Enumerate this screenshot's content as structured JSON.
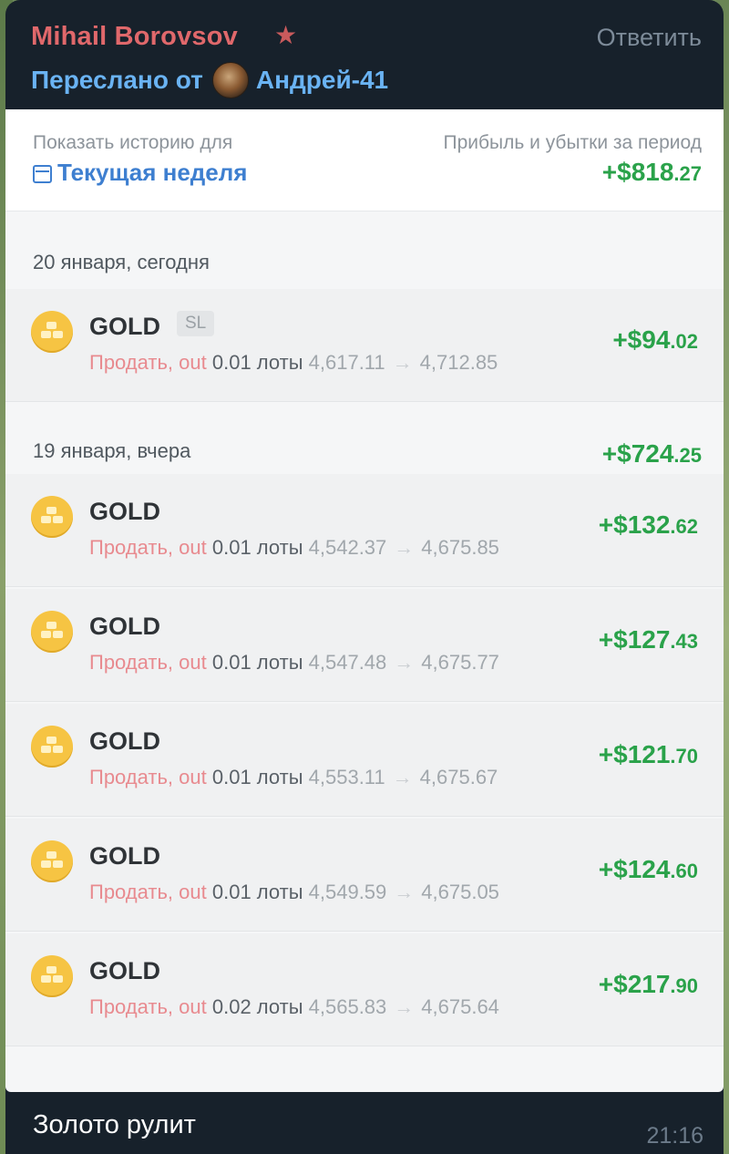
{
  "message": {
    "sender": "Mihail Borovsov",
    "reply_label": "Ответить",
    "forwarded_label": "Переслано от",
    "forwarded_from": "Андрей-41",
    "caption": "Золото рулит",
    "time": "21:16"
  },
  "summary": {
    "history_label": "Показать историю для",
    "period": "Текущая неделя",
    "pnl_label": "Прибыль и убытки за период",
    "pnl_main": "+$818",
    "pnl_cents": ".27"
  },
  "days": [
    {
      "label": "20 января, сегодня",
      "total_main": "",
      "total_cents": "",
      "trades": [
        {
          "symbol": "GOLD",
          "tag": "SL",
          "side": "Продать, out",
          "lots": "0.01 лоты",
          "open": "4,617.11",
          "close": "4,712.85",
          "profit_main": "+$94",
          "profit_cents": ".02"
        }
      ]
    },
    {
      "label": "19 января, вчера",
      "total_main": "+$724",
      "total_cents": ".25",
      "trades": [
        {
          "symbol": "GOLD",
          "tag": "",
          "side": "Продать, out",
          "lots": "0.01 лоты",
          "open": "4,542.37",
          "close": "4,675.85",
          "profit_main": "+$132",
          "profit_cents": ".62"
        },
        {
          "symbol": "GOLD",
          "tag": "",
          "side": "Продать, out",
          "lots": "0.01 лоты",
          "open": "4,547.48",
          "close": "4,675.77",
          "profit_main": "+$127",
          "profit_cents": ".43"
        },
        {
          "symbol": "GOLD",
          "tag": "",
          "side": "Продать, out",
          "lots": "0.01 лоты",
          "open": "4,553.11",
          "close": "4,675.67",
          "profit_main": "+$121",
          "profit_cents": ".70"
        },
        {
          "symbol": "GOLD",
          "tag": "",
          "side": "Продать, out",
          "lots": "0.01 лоты",
          "open": "4,549.59",
          "close": "4,675.05",
          "profit_main": "+$124",
          "profit_cents": ".60"
        },
        {
          "symbol": "GOLD",
          "tag": "",
          "side": "Продать, out",
          "lots": "0.02 лоты",
          "open": "4,565.83",
          "close": "4,675.64",
          "profit_main": "+$217",
          "profit_cents": ".90"
        }
      ]
    }
  ],
  "icons": {
    "star": "star-icon",
    "calendar": "calendar-icon",
    "coin": "gold-coin-icon",
    "arrow": "arrow-right-icon"
  },
  "colors": {
    "sender": "#e0686b",
    "link": "#6ab3f3",
    "profit": "#2aa24a",
    "sell": "#e88a8f",
    "period": "#3e7fd0"
  }
}
